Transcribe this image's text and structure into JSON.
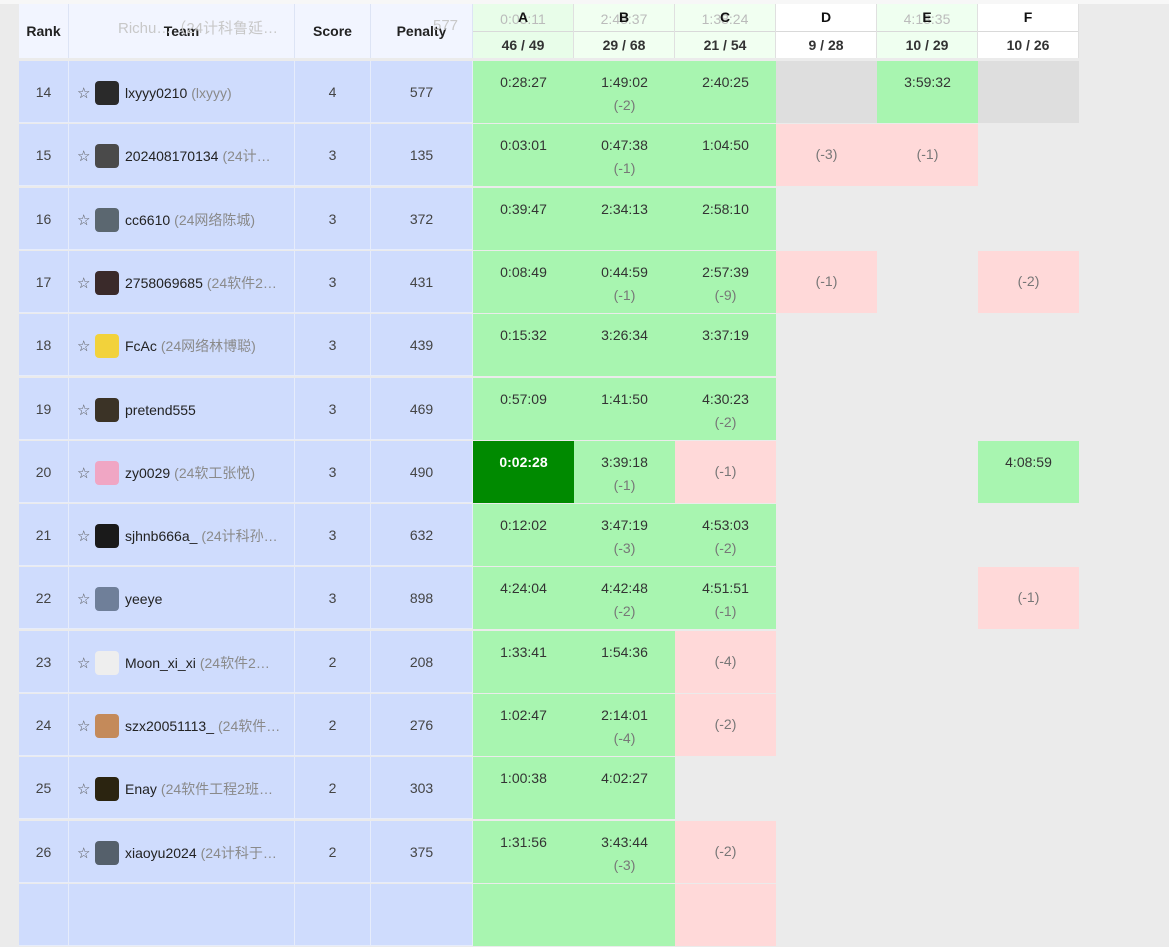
{
  "header": {
    "rank": "Rank",
    "team": "Team",
    "score": "Score",
    "penalty": "Penalty",
    "ghost_row_text": "Richu…（24计科鲁延…",
    "ghost_penalty": "577",
    "problems": [
      {
        "label": "A",
        "stat": "46 / 49",
        "ghost": "0:03:11",
        "bg": "#e8fde9"
      },
      {
        "label": "B",
        "stat": "29 / 68",
        "ghost": "2:48:37",
        "bg": "#f1fff1"
      },
      {
        "label": "C",
        "stat": "21 / 54",
        "ghost": "1:38:24",
        "bg": "#f1fff1"
      },
      {
        "label": "D",
        "stat": "9 / 28",
        "ghost": "",
        "bg": "#ffffff"
      },
      {
        "label": "E",
        "stat": "10 / 29",
        "ghost": "4:18:35",
        "bg": "#effff0"
      },
      {
        "label": "F",
        "stat": "10 / 26",
        "ghost": "",
        "bg": "#ffffff"
      }
    ]
  },
  "colors": {
    "accepted": "#a8f5b0",
    "wrong": "#ffd9d9",
    "pending": "#dedede",
    "first_blood": "#008a00",
    "info_bg": "#cfdcfd"
  },
  "rows": [
    {
      "rank": "14",
      "name": "lxyyy0210",
      "sub": "(lxyyy)",
      "score": "4",
      "penalty": "577",
      "avatar": "#2a2a2a",
      "cells": [
        {
          "s": "ac",
          "t": "0:28:27",
          "n": ""
        },
        {
          "s": "ac",
          "t": "1:49:02",
          "n": "(-2)"
        },
        {
          "s": "ac",
          "t": "2:40:25",
          "n": ""
        },
        {
          "s": "pend",
          "t": "",
          "n": ""
        },
        {
          "s": "ac",
          "t": "3:59:32",
          "n": ""
        },
        {
          "s": "pend",
          "t": "",
          "n": ""
        }
      ]
    },
    {
      "rank": "15",
      "name": "202408170134",
      "sub": "(24计…",
      "score": "3",
      "penalty": "135",
      "avatar": "#4a4a4a",
      "cells": [
        {
          "s": "ac",
          "t": "0:03:01",
          "n": ""
        },
        {
          "s": "ac",
          "t": "0:47:38",
          "n": "(-1)"
        },
        {
          "s": "ac",
          "t": "1:04:50",
          "n": ""
        },
        {
          "s": "wa",
          "t": "",
          "n": "(-3)"
        },
        {
          "s": "wa",
          "t": "",
          "n": "(-1)"
        },
        {
          "s": "none",
          "t": "",
          "n": ""
        }
      ]
    },
    {
      "rank": "16",
      "name": "cc6610",
      "sub": "(24网络陈城)",
      "score": "3",
      "penalty": "372",
      "avatar": "#5b6770",
      "cells": [
        {
          "s": "ac",
          "t": "0:39:47",
          "n": ""
        },
        {
          "s": "ac",
          "t": "2:34:13",
          "n": ""
        },
        {
          "s": "ac",
          "t": "2:58:10",
          "n": ""
        },
        {
          "s": "none",
          "t": "",
          "n": ""
        },
        {
          "s": "none",
          "t": "",
          "n": ""
        },
        {
          "s": "none",
          "t": "",
          "n": ""
        }
      ]
    },
    {
      "rank": "17",
      "name": "2758069685",
      "sub": "(24软件2…",
      "score": "3",
      "penalty": "431",
      "avatar": "#3a2a2a",
      "cells": [
        {
          "s": "ac",
          "t": "0:08:49",
          "n": ""
        },
        {
          "s": "ac",
          "t": "0:44:59",
          "n": "(-1)"
        },
        {
          "s": "ac",
          "t": "2:57:39",
          "n": "(-9)"
        },
        {
          "s": "wa",
          "t": "",
          "n": "(-1)"
        },
        {
          "s": "none",
          "t": "",
          "n": ""
        },
        {
          "s": "wa",
          "t": "",
          "n": "(-2)"
        }
      ]
    },
    {
      "rank": "18",
      "name": "FcAc",
      "sub": "(24网络林博聪)",
      "score": "3",
      "penalty": "439",
      "avatar": "#f2d23b",
      "cells": [
        {
          "s": "ac",
          "t": "0:15:32",
          "n": ""
        },
        {
          "s": "ac",
          "t": "3:26:34",
          "n": ""
        },
        {
          "s": "ac",
          "t": "3:37:19",
          "n": ""
        },
        {
          "s": "none",
          "t": "",
          "n": ""
        },
        {
          "s": "none",
          "t": "",
          "n": ""
        },
        {
          "s": "none",
          "t": "",
          "n": ""
        }
      ]
    },
    {
      "rank": "19",
      "name": "pretend555",
      "sub": "",
      "score": "3",
      "penalty": "469",
      "avatar": "#3b3326",
      "cells": [
        {
          "s": "ac",
          "t": "0:57:09",
          "n": ""
        },
        {
          "s": "ac",
          "t": "1:41:50",
          "n": ""
        },
        {
          "s": "ac",
          "t": "4:30:23",
          "n": "(-2)"
        },
        {
          "s": "none",
          "t": "",
          "n": ""
        },
        {
          "s": "none",
          "t": "",
          "n": ""
        },
        {
          "s": "none",
          "t": "",
          "n": ""
        }
      ]
    },
    {
      "rank": "20",
      "name": "zy0029",
      "sub": "(24软工张悦)",
      "score": "3",
      "penalty": "490",
      "avatar": "#f0a6c4",
      "cells": [
        {
          "s": "fb",
          "t": "0:02:28",
          "n": ""
        },
        {
          "s": "ac",
          "t": "3:39:18",
          "n": "(-1)"
        },
        {
          "s": "wa",
          "t": "",
          "n": "(-1)"
        },
        {
          "s": "none",
          "t": "",
          "n": ""
        },
        {
          "s": "none",
          "t": "",
          "n": ""
        },
        {
          "s": "ac",
          "t": "4:08:59",
          "n": ""
        }
      ]
    },
    {
      "rank": "21",
      "name": "sjhnb666a_",
      "sub": "(24计科孙…",
      "score": "3",
      "penalty": "632",
      "avatar": "#1a1a1a",
      "cells": [
        {
          "s": "ac",
          "t": "0:12:02",
          "n": ""
        },
        {
          "s": "ac",
          "t": "3:47:19",
          "n": "(-3)"
        },
        {
          "s": "ac",
          "t": "4:53:03",
          "n": "(-2)"
        },
        {
          "s": "none",
          "t": "",
          "n": ""
        },
        {
          "s": "none",
          "t": "",
          "n": ""
        },
        {
          "s": "none",
          "t": "",
          "n": ""
        }
      ]
    },
    {
      "rank": "22",
      "name": "yeeye",
      "sub": "",
      "score": "3",
      "penalty": "898",
      "avatar": "#6f7f99",
      "cells": [
        {
          "s": "ac",
          "t": "4:24:04",
          "n": ""
        },
        {
          "s": "ac",
          "t": "4:42:48",
          "n": "(-2)"
        },
        {
          "s": "ac",
          "t": "4:51:51",
          "n": "(-1)"
        },
        {
          "s": "none",
          "t": "",
          "n": ""
        },
        {
          "s": "none",
          "t": "",
          "n": ""
        },
        {
          "s": "wa",
          "t": "",
          "n": "(-1)"
        }
      ]
    },
    {
      "rank": "23",
      "name": "Moon_xi_xi",
      "sub": "(24软件2…",
      "score": "2",
      "penalty": "208",
      "avatar": "#eeeeee",
      "cells": [
        {
          "s": "ac",
          "t": "1:33:41",
          "n": ""
        },
        {
          "s": "ac",
          "t": "1:54:36",
          "n": ""
        },
        {
          "s": "wa",
          "t": "",
          "n": "(-4)"
        },
        {
          "s": "none",
          "t": "",
          "n": ""
        },
        {
          "s": "none",
          "t": "",
          "n": ""
        },
        {
          "s": "none",
          "t": "",
          "n": ""
        }
      ]
    },
    {
      "rank": "24",
      "name": "szx20051113_",
      "sub": "(24软件…",
      "score": "2",
      "penalty": "276",
      "avatar": "#c48a5a",
      "cells": [
        {
          "s": "ac",
          "t": "1:02:47",
          "n": ""
        },
        {
          "s": "ac",
          "t": "2:14:01",
          "n": "(-4)"
        },
        {
          "s": "wa",
          "t": "",
          "n": "(-2)"
        },
        {
          "s": "none",
          "t": "",
          "n": ""
        },
        {
          "s": "none",
          "t": "",
          "n": ""
        },
        {
          "s": "none",
          "t": "",
          "n": ""
        }
      ]
    },
    {
      "rank": "25",
      "name": "Enay",
      "sub": "(24软件工程2班…",
      "score": "2",
      "penalty": "303",
      "avatar": "#2b2410",
      "cells": [
        {
          "s": "ac",
          "t": "1:00:38",
          "n": ""
        },
        {
          "s": "ac",
          "t": "4:02:27",
          "n": ""
        },
        {
          "s": "none",
          "t": "",
          "n": ""
        },
        {
          "s": "none",
          "t": "",
          "n": ""
        },
        {
          "s": "none",
          "t": "",
          "n": ""
        },
        {
          "s": "none",
          "t": "",
          "n": ""
        }
      ]
    },
    {
      "rank": "26",
      "name": "xiaoyu2024",
      "sub": "(24计科于…",
      "score": "2",
      "penalty": "375",
      "avatar": "#55606b",
      "cells": [
        {
          "s": "ac",
          "t": "1:31:56",
          "n": ""
        },
        {
          "s": "ac",
          "t": "3:43:44",
          "n": "(-3)"
        },
        {
          "s": "wa",
          "t": "",
          "n": "(-2)"
        },
        {
          "s": "none",
          "t": "",
          "n": ""
        },
        {
          "s": "none",
          "t": "",
          "n": ""
        },
        {
          "s": "none",
          "t": "",
          "n": ""
        }
      ]
    },
    {
      "rank": "",
      "name": "",
      "sub": "",
      "score": "",
      "penalty": "",
      "avatar": "#cfdcfd",
      "cells": [
        {
          "s": "ac",
          "t": "",
          "n": ""
        },
        {
          "s": "ac",
          "t": "",
          "n": ""
        },
        {
          "s": "wa",
          "t": "",
          "n": ""
        },
        {
          "s": "none",
          "t": "",
          "n": ""
        },
        {
          "s": "none",
          "t": "",
          "n": ""
        },
        {
          "s": "none",
          "t": "",
          "n": ""
        }
      ]
    }
  ]
}
